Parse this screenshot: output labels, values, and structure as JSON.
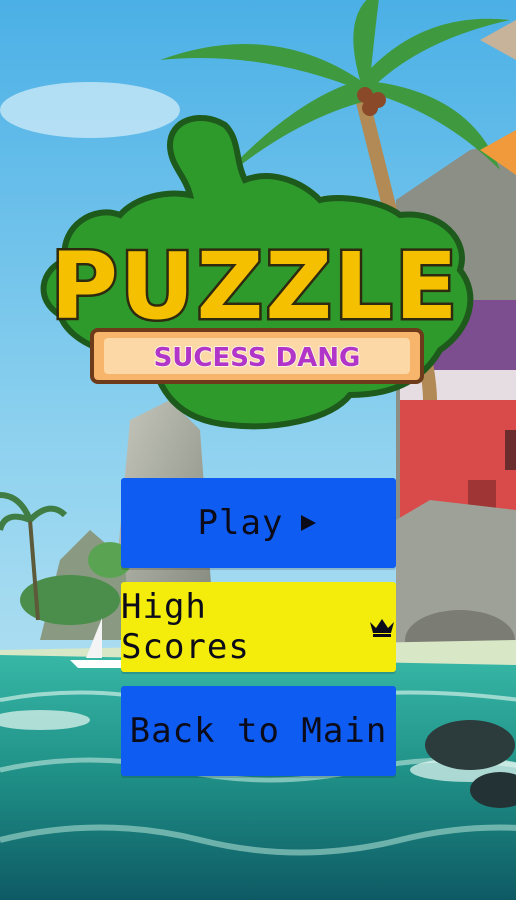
{
  "logo": {
    "title": "PUZZLE",
    "subtitle": "SUCESS DANG"
  },
  "menu": {
    "play_label": "Play",
    "play_icon": "play-icon",
    "high_scores_label": "High Scores",
    "high_scores_icon": "crown-icon",
    "back_label": "Back to Main"
  },
  "colors": {
    "button_blue": "#0f5cf2",
    "button_yellow": "#f4ec0a",
    "puzzle_green": "#2f9a2c",
    "title_yellow": "#f5c000",
    "subtitle_purple": "#b235c9"
  }
}
